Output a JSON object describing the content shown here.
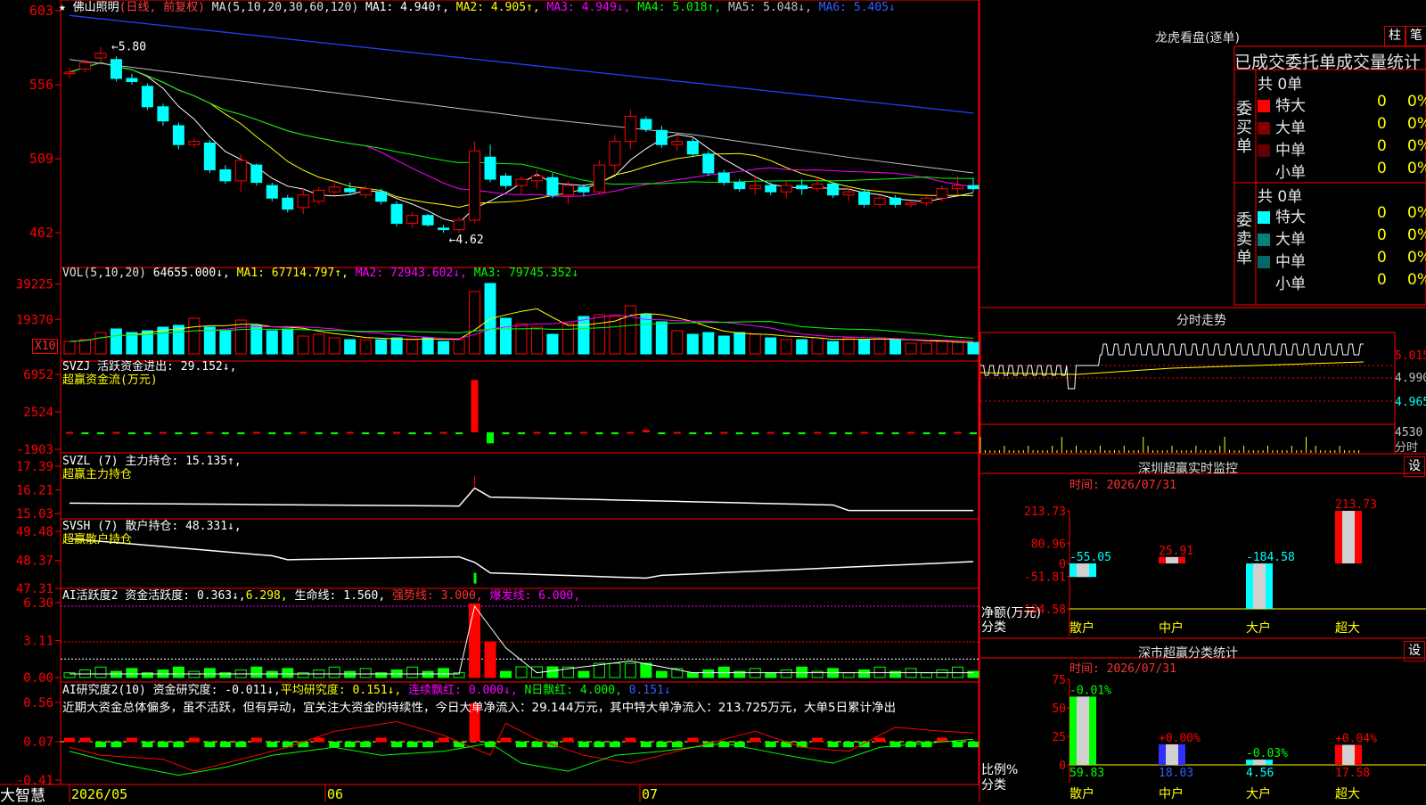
{
  "header": {
    "stock_name": "★ 佛山照明",
    "period": "(日线, 前复权)",
    "ma_label": "MA(5,10,20,30,60,120)",
    "ma1": "MA1: 4.940↑,",
    "ma2": "MA2: 4.905↑,",
    "ma3": "MA3: 4.949↓,",
    "ma4": "MA4: 5.018↑,",
    "ma5": "MA5: 5.048↓,",
    "ma6": "MA6: 5.405↓"
  },
  "price_axis": [
    "603",
    "556",
    "509",
    "462"
  ],
  "price_labels": {
    "high": "5.80",
    "low": "4.62"
  },
  "vol_panel": {
    "label": "VOL(5,10,20)",
    "value": "64655.000↓,",
    "ma1": "MA1: 67714.797↑,",
    "ma2": "MA2: 72943.602↓,",
    "ma3": "MA3: 79745.352↓",
    "axis": [
      "39225",
      "19370"
    ],
    "unit": "X10"
  },
  "svzj_panel": {
    "label": "SVZJ  活跃资金进出: 29.152↓,",
    "sub": "超赢资金流(万元)",
    "axis": [
      "6952",
      "2524",
      "-1903"
    ]
  },
  "svzl_panel": {
    "label": "SVZL (7) 主力持仓: 15.135↑,",
    "sub": "超赢主力持仓",
    "axis": [
      "17.39",
      "16.21",
      "15.03"
    ]
  },
  "svsh_panel": {
    "label": "SVSH (7) 散户持仓: 48.331↓,",
    "sub": "超赢散户持仓",
    "axis": [
      "49.48",
      "48.37",
      "47.31"
    ]
  },
  "ai_activity_panel": {
    "label": "AI活跃度2 资金活跃度: 0.363↓,",
    "v2": "6.298,",
    "life": "生命线: 1.560,",
    "strong": "强势线: 3.000,",
    "burst": "爆发线: 6.000,",
    "axis": [
      "6.30",
      "3.11",
      "0.00"
    ]
  },
  "ai_research_panel": {
    "label": "AI研究度2(10) 资金研究度: -0.011↓,",
    "avg": "平均研究度: 0.151↓,",
    "streak": "连续飘红: 0.000↓,",
    "nday": "N日飘红: 4.000,",
    "last": "0.151↓",
    "commentary": "近期大资金总体偏多，虽不活跃，但有异动，宜关注大资金的持续性，今日大单净流入：29.144万元，其中特大单净流入：213.725万元，大单5日累计净出",
    "axis": [
      "0.56",
      "0.07",
      "-0.41"
    ]
  },
  "date_axis": [
    "2026/05",
    "06",
    "07"
  ],
  "brand": "大智慧",
  "right_panel": {
    "dragon_tiger_title": "龙虎看盘(逐单)",
    "btn_zhu": "柱",
    "btn_bi": "笔",
    "stats_title": "已成交委托单成交量统计",
    "buy_label": "委买单",
    "sell_label": "委卖单",
    "buy_total": "共 0单",
    "sell_total": "共 0单",
    "buy_rows": [
      {
        "name": "特大",
        "count": "0",
        "pct": "0%",
        "color": "#ff0000"
      },
      {
        "name": "大单",
        "count": "0",
        "pct": "0%",
        "color": "#800000"
      },
      {
        "name": "中单",
        "count": "0",
        "pct": "0%",
        "color": "#600000"
      },
      {
        "name": "小单",
        "count": "0",
        "pct": "0%",
        "color": "#000000"
      }
    ],
    "sell_rows": [
      {
        "name": "特大",
        "count": "0",
        "pct": "0%",
        "color": "#00ffff"
      },
      {
        "name": "大单",
        "count": "0",
        "pct": "0%",
        "color": "#008080"
      },
      {
        "name": "中单",
        "count": "0",
        "pct": "0%",
        "color": "#006868"
      },
      {
        "name": "小单",
        "count": "0",
        "pct": "0%",
        "color": "#000000"
      }
    ],
    "intraday_title": "分时走势",
    "intraday_axis": [
      "5.015",
      "4.990",
      "4.965"
    ],
    "intraday_vol": "4530",
    "intraday_unit": "分时",
    "monitor_title": "深圳超赢实时监控",
    "monitor_btn": "设",
    "monitor_time": "时间: 2026/07/31",
    "monitor_axis": [
      "213.73",
      "80.96",
      "0",
      "-51.81",
      "-184.58"
    ],
    "monitor_ylabel": "净额(万元)",
    "monitor_xlabel": "分类",
    "classify_title": "深市超赢分类统计",
    "classify_btn": "设",
    "classify_time": "时间: 2026/07/31",
    "classify_axis": [
      "75",
      "50",
      "25",
      "0"
    ],
    "classify_ylabel": "比例%",
    "classify_xlabel": "分类"
  },
  "chart_data": [
    {
      "type": "candlestick",
      "title": "佛山照明 (日线, 前复权)",
      "x_start": "2026/05",
      "ohlc": [
        [
          5.63,
          5.67,
          5.6,
          5.64
        ],
        [
          5.66,
          5.72,
          5.64,
          5.7
        ],
        [
          5.73,
          5.8,
          5.7,
          5.76
        ],
        [
          5.72,
          5.74,
          5.58,
          5.6
        ],
        [
          5.6,
          5.63,
          5.56,
          5.58
        ],
        [
          5.55,
          5.57,
          5.4,
          5.42
        ],
        [
          5.42,
          5.44,
          5.3,
          5.33
        ],
        [
          5.3,
          5.32,
          5.15,
          5.18
        ],
        [
          5.18,
          5.22,
          5.16,
          5.2
        ],
        [
          5.19,
          5.21,
          5.0,
          5.02
        ],
        [
          5.02,
          5.05,
          4.93,
          4.95
        ],
        [
          4.95,
          5.12,
          4.88,
          5.08
        ],
        [
          5.05,
          5.06,
          4.92,
          4.94
        ],
        [
          4.92,
          4.94,
          4.82,
          4.84
        ],
        [
          4.84,
          4.86,
          4.75,
          4.77
        ],
        [
          4.78,
          4.9,
          4.74,
          4.86
        ],
        [
          4.82,
          4.91,
          4.8,
          4.89
        ],
        [
          4.88,
          4.95,
          4.86,
          4.91
        ],
        [
          4.9,
          4.94,
          4.86,
          4.88
        ],
        [
          4.86,
          4.92,
          4.84,
          4.9
        ],
        [
          4.88,
          4.9,
          4.8,
          4.82
        ],
        [
          4.8,
          4.82,
          4.66,
          4.68
        ],
        [
          4.68,
          4.75,
          4.65,
          4.73
        ],
        [
          4.73,
          4.74,
          4.66,
          4.67
        ],
        [
          4.65,
          4.67,
          4.62,
          4.64
        ],
        [
          4.64,
          4.72,
          4.62,
          4.7
        ],
        [
          4.7,
          5.2,
          4.68,
          5.14
        ],
        [
          5.1,
          5.18,
          4.94,
          4.96
        ],
        [
          4.98,
          5.0,
          4.9,
          4.92
        ],
        [
          4.92,
          4.98,
          4.86,
          4.96
        ],
        [
          4.95,
          5.02,
          4.9,
          4.98
        ],
        [
          4.97,
          5.0,
          4.84,
          4.86
        ],
        [
          4.86,
          4.95,
          4.8,
          4.92
        ],
        [
          4.91,
          4.93,
          4.85,
          4.88
        ],
        [
          4.88,
          5.08,
          4.87,
          5.05
        ],
        [
          5.05,
          5.24,
          5.0,
          5.2
        ],
        [
          5.2,
          5.4,
          5.15,
          5.36
        ],
        [
          5.34,
          5.36,
          5.26,
          5.28
        ],
        [
          5.27,
          5.3,
          5.16,
          5.18
        ],
        [
          5.18,
          5.24,
          5.14,
          5.2
        ],
        [
          5.2,
          5.22,
          5.1,
          5.12
        ],
        [
          5.12,
          5.14,
          4.98,
          5.0
        ],
        [
          5.0,
          5.02,
          4.92,
          4.94
        ],
        [
          4.94,
          4.96,
          4.88,
          4.9
        ],
        [
          4.9,
          4.98,
          4.86,
          4.92
        ],
        [
          4.92,
          4.94,
          4.86,
          4.88
        ],
        [
          4.88,
          4.95,
          4.84,
          4.92
        ],
        [
          4.92,
          4.96,
          4.86,
          4.9
        ],
        [
          4.9,
          4.97,
          4.88,
          4.93
        ],
        [
          4.93,
          4.94,
          4.84,
          4.86
        ],
        [
          4.86,
          4.9,
          4.82,
          4.88
        ],
        [
          4.88,
          4.9,
          4.78,
          4.8
        ],
        [
          4.8,
          4.86,
          4.78,
          4.84
        ],
        [
          4.84,
          4.86,
          4.78,
          4.8
        ],
        [
          4.8,
          4.82,
          4.78,
          4.81
        ],
        [
          4.81,
          4.85,
          4.79,
          4.84
        ],
        [
          4.84,
          4.92,
          4.82,
          4.9
        ],
        [
          4.9,
          4.98,
          4.86,
          4.92
        ],
        [
          4.92,
          4.97,
          4.88,
          4.9
        ]
      ],
      "ylim": [
        4.4,
        6.03
      ]
    },
    {
      "type": "bar",
      "title": "VOL(5,10,20)",
      "values": [
        7000,
        8000,
        12000,
        14000,
        12000,
        13000,
        15000,
        16000,
        20000,
        15000,
        13000,
        19000,
        16000,
        13000,
        14000,
        10000,
        11000,
        9000,
        8000,
        8000,
        8000,
        9000,
        8000,
        9000,
        7000,
        8000,
        35000,
        39500,
        20000,
        17000,
        15000,
        11000,
        17000,
        21000,
        22000,
        21000,
        27000,
        22000,
        18000,
        13000,
        11000,
        12000,
        10000,
        12000,
        11000,
        9000,
        8000,
        8000,
        9000,
        7000,
        9000,
        8000,
        9000,
        8000,
        6000,
        6000,
        7000,
        6500,
        6465
      ],
      "ylim": [
        0,
        41000
      ]
    }
  ]
}
